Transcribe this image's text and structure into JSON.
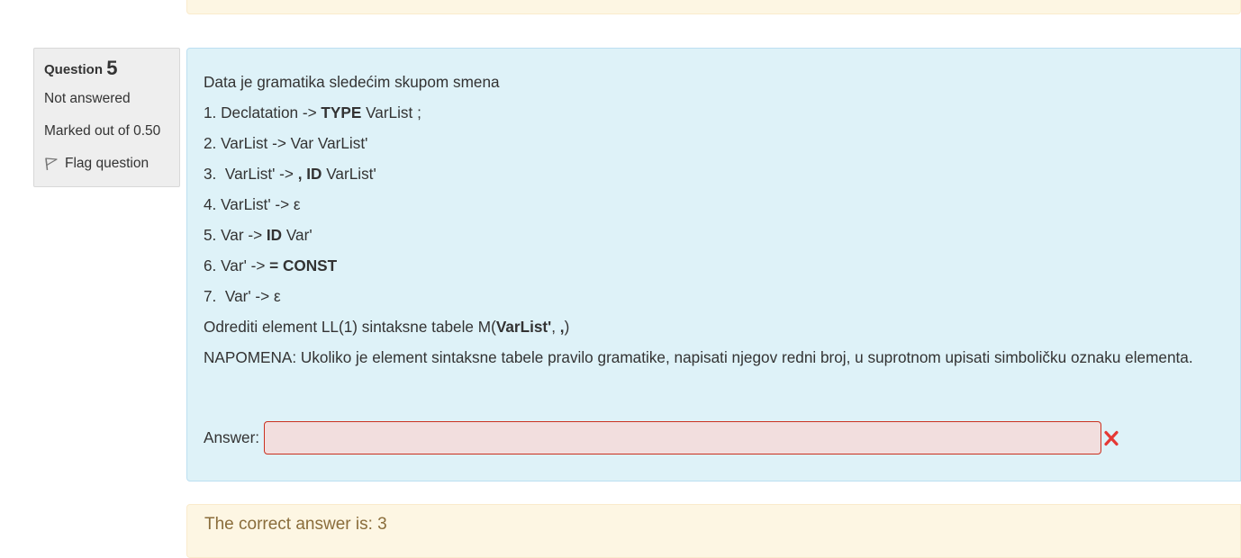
{
  "question": {
    "label": "Question",
    "number": "5",
    "state": "Not answered",
    "grade": "Marked out of 0.50",
    "flag_label": "Flag question",
    "flag_icon": "flag-icon"
  },
  "qtext": {
    "line0": "Data je gramatika sledećim skupom smena",
    "line1": [
      "1. Declatation -> ",
      "TYPE",
      " VarList ;"
    ],
    "line2": "2. VarList -> Var VarList'",
    "line3": [
      "3.  VarList' -> ",
      ", ID",
      " VarList'"
    ],
    "line4": "4. VarList' -> ε",
    "line5": [
      "5. Var -> ",
      "ID",
      " Var'"
    ],
    "line6": [
      "6. Var' -> ",
      "= CONST"
    ],
    "line7": "7.  Var' -> ε",
    "line8": [
      "Odrediti element LL(1) sintaksne tabele M(",
      "VarList'",
      ", ",
      ",",
      ")"
    ],
    "line9": "NAPOMENA: Ukoliko je element sintaksne tabele pravilo gramatike, napisati njegov redni broj, u suprotnom upisati simboličku oznaku elementa."
  },
  "answer": {
    "label": "Answer:",
    "value": "",
    "status_icon": "incorrect-icon",
    "status_color": "#e53935"
  },
  "feedback": {
    "right_answer": "The correct answer is: 3"
  },
  "colors": {
    "content_bg": "#def2f8",
    "info_bg": "#eeeeee",
    "feedback_bg": "#fdf6e3",
    "input_bg": "#f2dede",
    "input_border": "#ca3120"
  }
}
